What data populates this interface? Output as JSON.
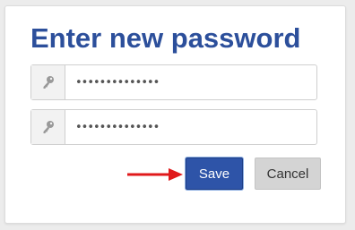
{
  "dialog": {
    "title": "Enter new password"
  },
  "fields": [
    {
      "icon": "key-icon",
      "value": "••••••••••••••"
    },
    {
      "icon": "key-icon",
      "value": "••••••••••••••"
    }
  ],
  "buttons": {
    "save_label": "Save",
    "cancel_label": "Cancel"
  },
  "colors": {
    "title": "#2c4f9b",
    "save_bg": "#2e54a8",
    "cancel_bg": "#d4d4d4",
    "arrow": "#e0191b"
  }
}
